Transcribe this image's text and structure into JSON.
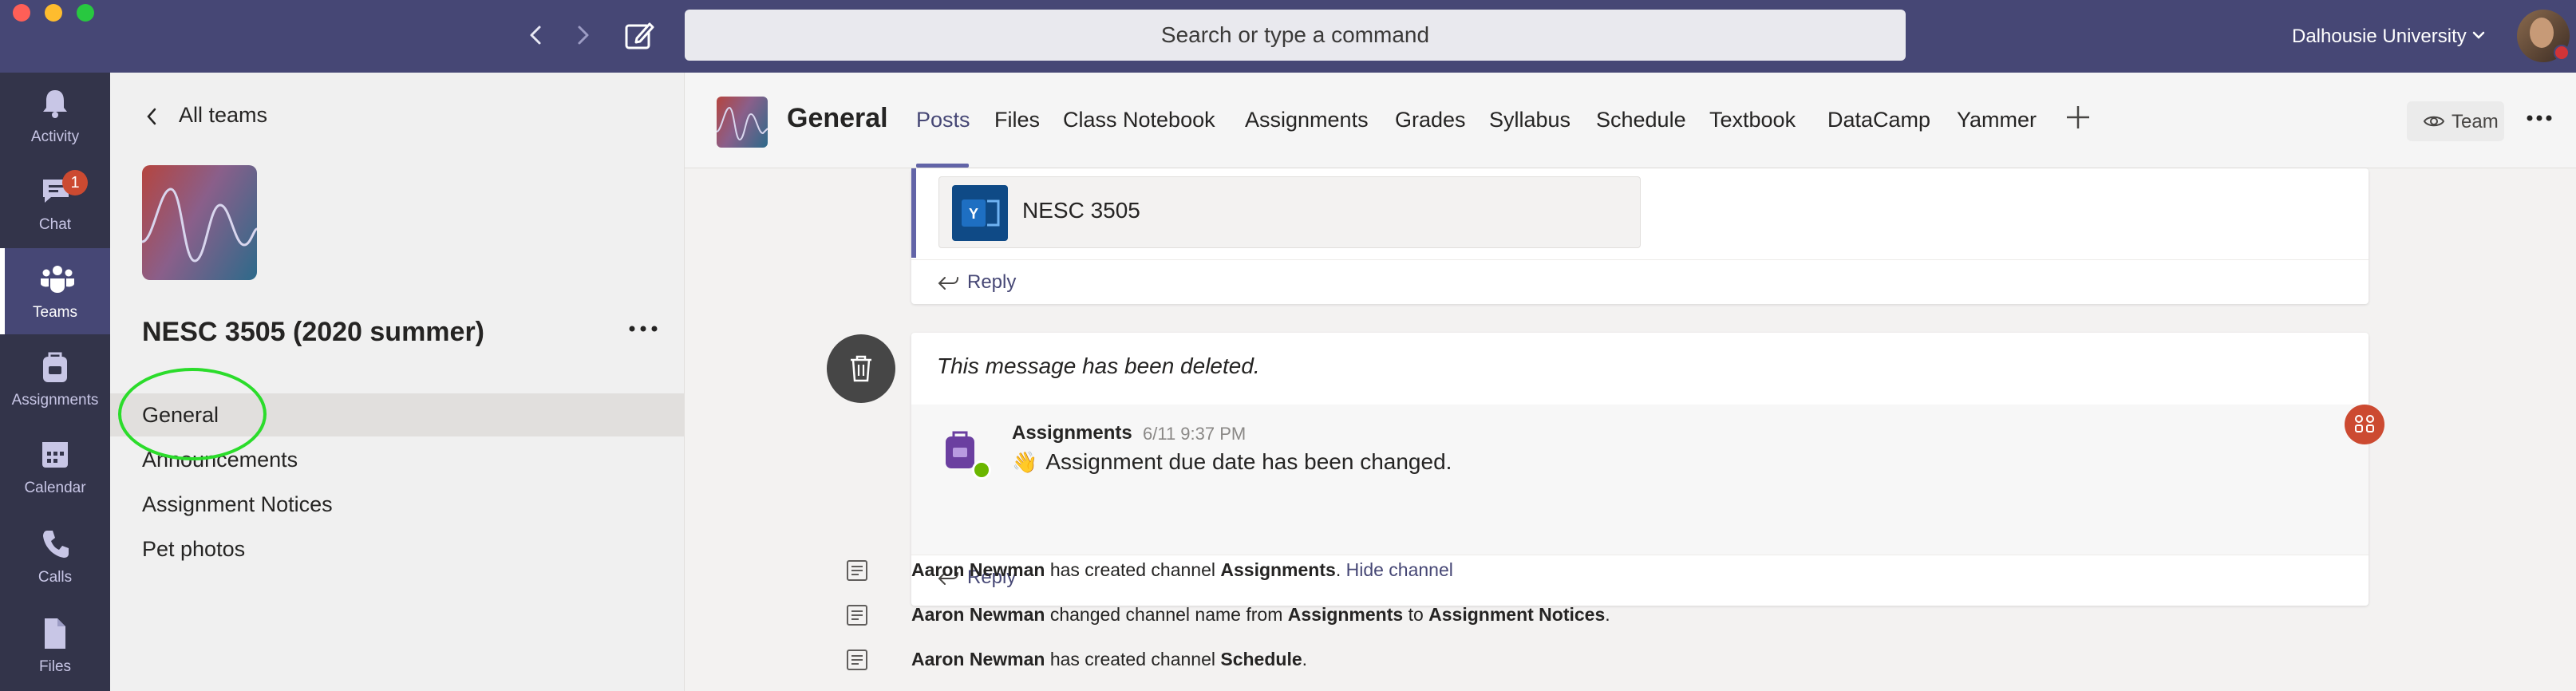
{
  "window": {
    "search_placeholder": "Search or type a command",
    "organization": "Dalhousie University"
  },
  "rail": {
    "items": [
      {
        "label": "Activity",
        "icon": "bell-icon"
      },
      {
        "label": "Chat",
        "icon": "chat-icon",
        "badge": "1"
      },
      {
        "label": "Teams",
        "icon": "teams-icon",
        "active": true
      },
      {
        "label": "Assignments",
        "icon": "assignments-icon"
      },
      {
        "label": "Calendar",
        "icon": "calendar-icon"
      },
      {
        "label": "Calls",
        "icon": "phone-icon"
      },
      {
        "label": "Files",
        "icon": "file-icon"
      }
    ]
  },
  "team": {
    "back_label": "All teams",
    "name": "NESC 3505 (2020 summer)",
    "channels": [
      "General",
      "Announcements",
      "Assignment Notices",
      "Pet photos"
    ],
    "active_channel": "General"
  },
  "header": {
    "channel_title": "General",
    "tabs": [
      "Posts",
      "Files",
      "Class Notebook",
      "Assignments",
      "Grades",
      "Syllabus",
      "Schedule",
      "Textbook",
      "DataCamp",
      "Yammer"
    ],
    "active_tab": "Posts",
    "team_button": "Team"
  },
  "posts": {
    "file_card": {
      "name": "NESC 3505",
      "reply_label": "Reply"
    },
    "deleted_message": "This message has been deleted.",
    "reply": {
      "author": "Assignments",
      "time": "6/11 9:37 PM",
      "text": "Assignment due date has been changed.",
      "emoji": "👋"
    },
    "reply_label": "Reply",
    "system_events": [
      {
        "actor": "Aaron Newman",
        "text_1": "has created channel",
        "channel": "Assignments",
        "link": "Hide channel"
      },
      {
        "actor": "Aaron Newman",
        "text_1": "changed channel name from",
        "from": "Assignments",
        "to_word": "to",
        "to": "Assignment Notices"
      },
      {
        "actor": "Aaron Newman",
        "text_1": "has created channel",
        "channel": "Schedule"
      }
    ]
  },
  "colors": {
    "titlebar": "#464775",
    "rail": "#33344a",
    "accent": "#6264a7",
    "badge": "#cc4a31",
    "highlight_circle": "#2bdc2b"
  }
}
